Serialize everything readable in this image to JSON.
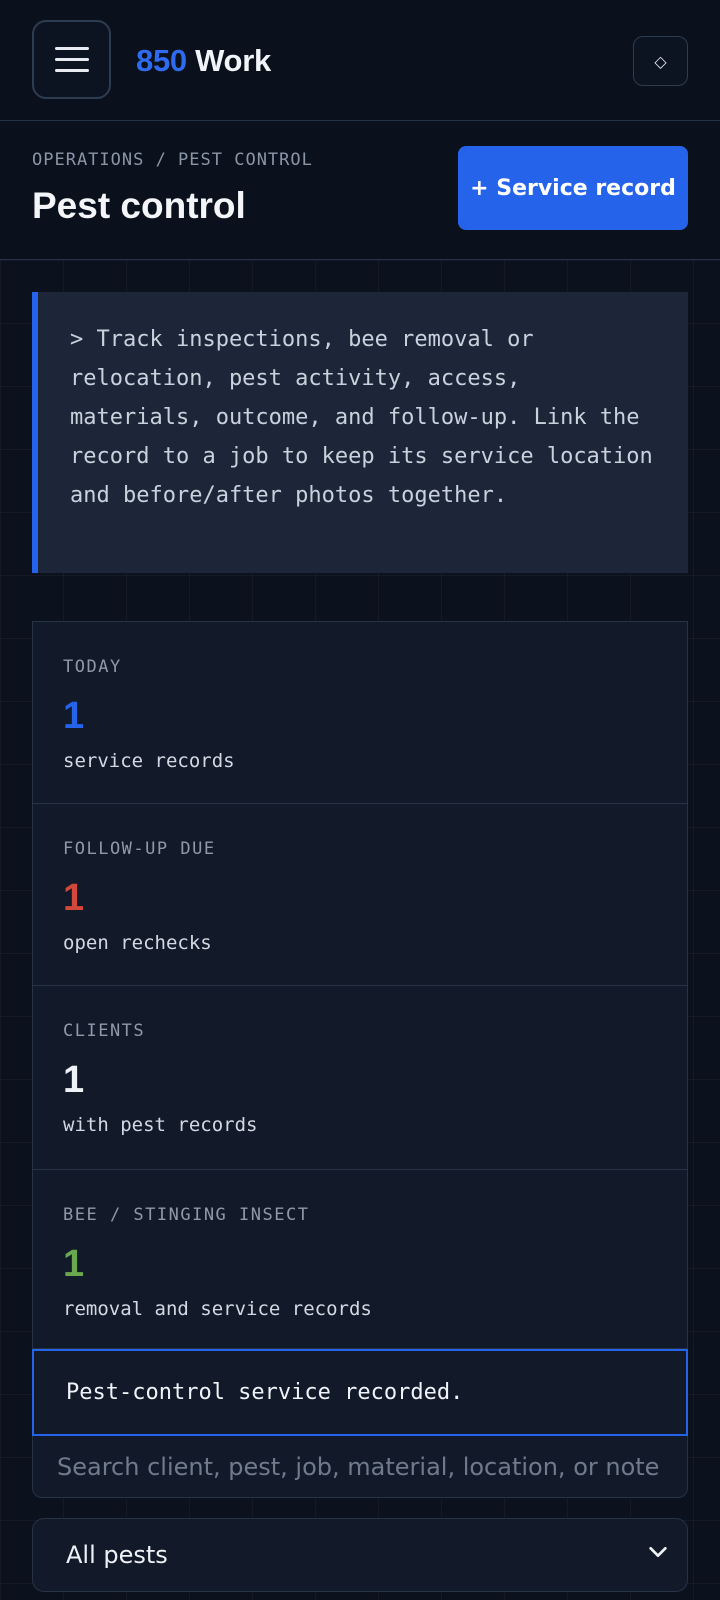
{
  "brand": {
    "number": "850",
    "word": "Work"
  },
  "topbar": {
    "theme_icon": "diamond-icon",
    "theme_glyph": "◇"
  },
  "header": {
    "breadcrumb": "OPERATIONS / PEST CONTROL",
    "title": "Pest control",
    "primary_action": "+ Service record"
  },
  "intro": "> Track inspections, bee removal or relocation, pest activity, access, materials, outcome, and follow-up. Link the record to a job to keep its service location and before/after photos together.",
  "stats": [
    {
      "label": "TODAY",
      "value": "1",
      "sub": "service records",
      "color": "#2563eb"
    },
    {
      "label": "FOLLOW-UP DUE",
      "value": "1",
      "sub": "open rechecks",
      "color": "#d2483a"
    },
    {
      "label": "CLIENTS",
      "value": "1",
      "sub": "with pest records",
      "color": "#eef2f7"
    },
    {
      "label": "BEE / STINGING INSECT",
      "value": "1",
      "sub": "removal and service records",
      "color": "#6aa84f"
    }
  ],
  "toast": "Pest-control service recorded.",
  "search": {
    "placeholder": "Search client, pest, job, material, location, or note",
    "value": ""
  },
  "filter": {
    "selected": "All pests"
  },
  "colors": {
    "accent": "#2563eb",
    "background": "#0b111d",
    "panel": "#121a2a"
  }
}
